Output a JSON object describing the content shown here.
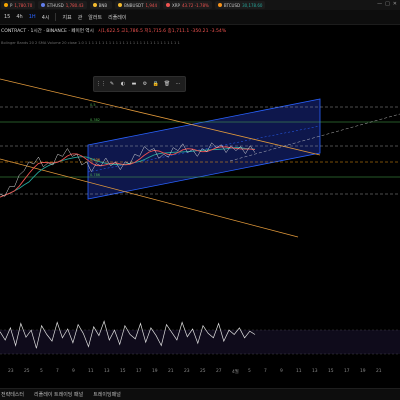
{
  "browser_tabs": [
    {
      "label": "P",
      "value": "1,780.70",
      "dot": "#f7a600",
      "value_color": "red"
    },
    {
      "label": "ETHUSD",
      "value": "1,780.43",
      "dot": "#627eea",
      "value_color": "red"
    },
    {
      "label": "BNB",
      "value": "",
      "dot": "#f3ba2f",
      "value_color": "red"
    },
    {
      "label": "BNBUSDT",
      "value": "1,944",
      "dot": "#f3ba2f",
      "value_color": "red"
    },
    {
      "label": "XRP",
      "value": "43.72 -1.78%",
      "dot": "#ef5350",
      "value_color": "red"
    },
    {
      "label": "BTCUSD",
      "value": "30,178.60",
      "dot": "#f7931a",
      "value_color": "green"
    }
  ],
  "window_controls": [
    "—",
    "□",
    "✕"
  ],
  "toolbar": {
    "items": [
      "15",
      "4h",
      "1H",
      "4시",
      "지표",
      "관",
      "알러트",
      "리플레이"
    ],
    "active_index": 2
  },
  "symbol": {
    "title": "CONTRACT · 1시간 · BINANCE · 페이먼 역시",
    "ohlc": "시1,622.5 고1,786.5 저1,715.6 종1,711.1 -350.21 -3.54%"
  },
  "indicator_line": "Bolinger Bands 20 2 SMA  Volume 20 close  1.0 1 1 1 1 1 1 1 1 1 1 1 1 1 1 1 1 1 1 1 1 1 1 1 1 1 1 1 1",
  "drawing_toolbar": {
    "icons": [
      "drag-icon",
      "pencil-icon",
      "brush-icon",
      "line-weight-icon",
      "settings-icon",
      "lock-icon",
      "trash-icon",
      "more-icon"
    ]
  },
  "price_labels": [
    "0.5",
    "0.382",
    "0.236",
    "0.786"
  ],
  "xaxis_labels": [
    "23",
    "25",
    "5",
    "7",
    "9",
    "11",
    "13",
    "15",
    "17",
    "19",
    "21",
    "23",
    "25",
    "27",
    "4월",
    "5",
    "7",
    "9",
    "11",
    "13",
    "15",
    "17",
    "19",
    "21"
  ],
  "footer": {
    "items": [
      "전략테스터",
      "리플레이 트레이딩 패널",
      "트레이딩패널"
    ]
  },
  "chart_data": {
    "type": "line",
    "title": "",
    "price_series_shape": [
      62,
      66,
      70,
      76,
      82,
      93,
      96,
      100,
      101,
      97,
      95,
      99,
      104,
      108,
      110,
      108,
      104,
      99,
      96,
      92,
      94,
      98,
      100,
      98,
      96,
      94,
      96,
      100,
      104,
      108,
      112,
      114,
      110,
      106,
      104,
      107,
      111,
      114,
      115,
      112,
      109,
      108,
      110,
      113,
      116,
      117,
      114,
      112,
      113,
      114,
      112,
      111,
      113,
      112
    ],
    "oscillator_series_shape": [
      55,
      40,
      62,
      30,
      70,
      45,
      58,
      25,
      66,
      50,
      38,
      72,
      44,
      60,
      35,
      68,
      52,
      28,
      64,
      48,
      74,
      40,
      58,
      32,
      66,
      50,
      42,
      70,
      36,
      62,
      48,
      30,
      68,
      54,
      40,
      72,
      46,
      60,
      34,
      66,
      52,
      44,
      70,
      38,
      58,
      50,
      62,
      44,
      56,
      50
    ],
    "colors": {
      "channel_fill": "#1a2a8a",
      "channel_edge": "#2962ff",
      "trend_orange": "#e39a3b",
      "ma_red": "#ef5350",
      "ma_green": "#26a69a",
      "oscillator": "#e0e0e0",
      "fib_green": "#4caf50",
      "fib_orange": "#f39c12"
    }
  }
}
